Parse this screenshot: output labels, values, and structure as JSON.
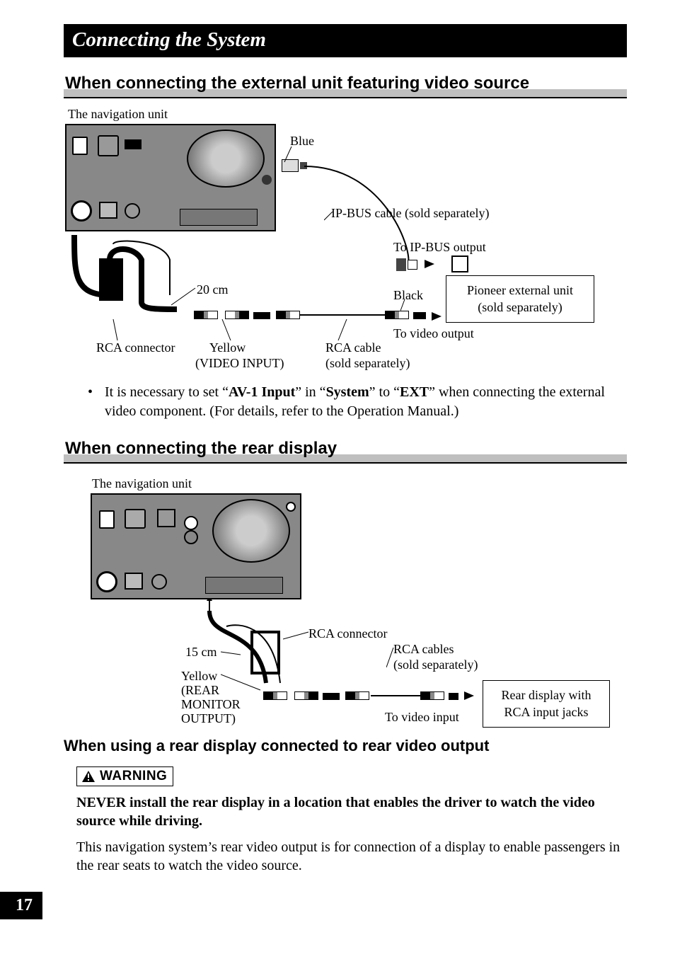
{
  "chapterTitle": "Connecting the System",
  "section1": {
    "title": "When connecting the external unit featuring video source",
    "labels": {
      "navUnit": "The navigation unit",
      "blue": "Blue",
      "ipbusCable": "IP-BUS cable (sold separately)",
      "toIpbus": "To IP-BUS output",
      "twentyCm": "20 cm",
      "black": "Black",
      "extUnit1": "Pioneer external unit",
      "extUnit2": "(sold separately)",
      "toVideo": "To video output",
      "rcaConn": "RCA connector",
      "yellow": "Yellow",
      "videoInput": "(VIDEO INPUT)",
      "rcaCable": "RCA cable",
      "soldSep": "(sold separately)"
    },
    "note": {
      "pre": "It is necessary to set “",
      "av1": "AV-1 Input",
      "mid1": "” in “",
      "system": "System",
      "mid2": "” to “",
      "ext": "EXT",
      "post": "” when connecting the external video component. (For details, refer to the Operation Manual.)"
    }
  },
  "section2": {
    "title": "When connecting the rear display",
    "labels": {
      "navUnit": "The navigation unit",
      "rcaConn": "RCA connector",
      "fifteenCm": "15 cm",
      "rcaCables": "RCA cables",
      "soldSep": "(sold separately)",
      "yellow": "Yellow",
      "rear": "(REAR",
      "monitor": "MONITOR",
      "output": "OUTPUT)",
      "toVideoIn": "To video input",
      "rearDisp1": "Rear display with",
      "rearDisp2": "RCA input jacks"
    }
  },
  "section3": {
    "title": "When using a rear display connected to rear video output",
    "warningLabel": "WARNING",
    "warningBold": "NEVER install the rear display in a location that enables the driver to watch the video source while driving.",
    "bodyText": "This navigation system’s rear video output is for connection of a display to enable passengers in the rear seats to watch the video source."
  },
  "pageNumber": "17"
}
